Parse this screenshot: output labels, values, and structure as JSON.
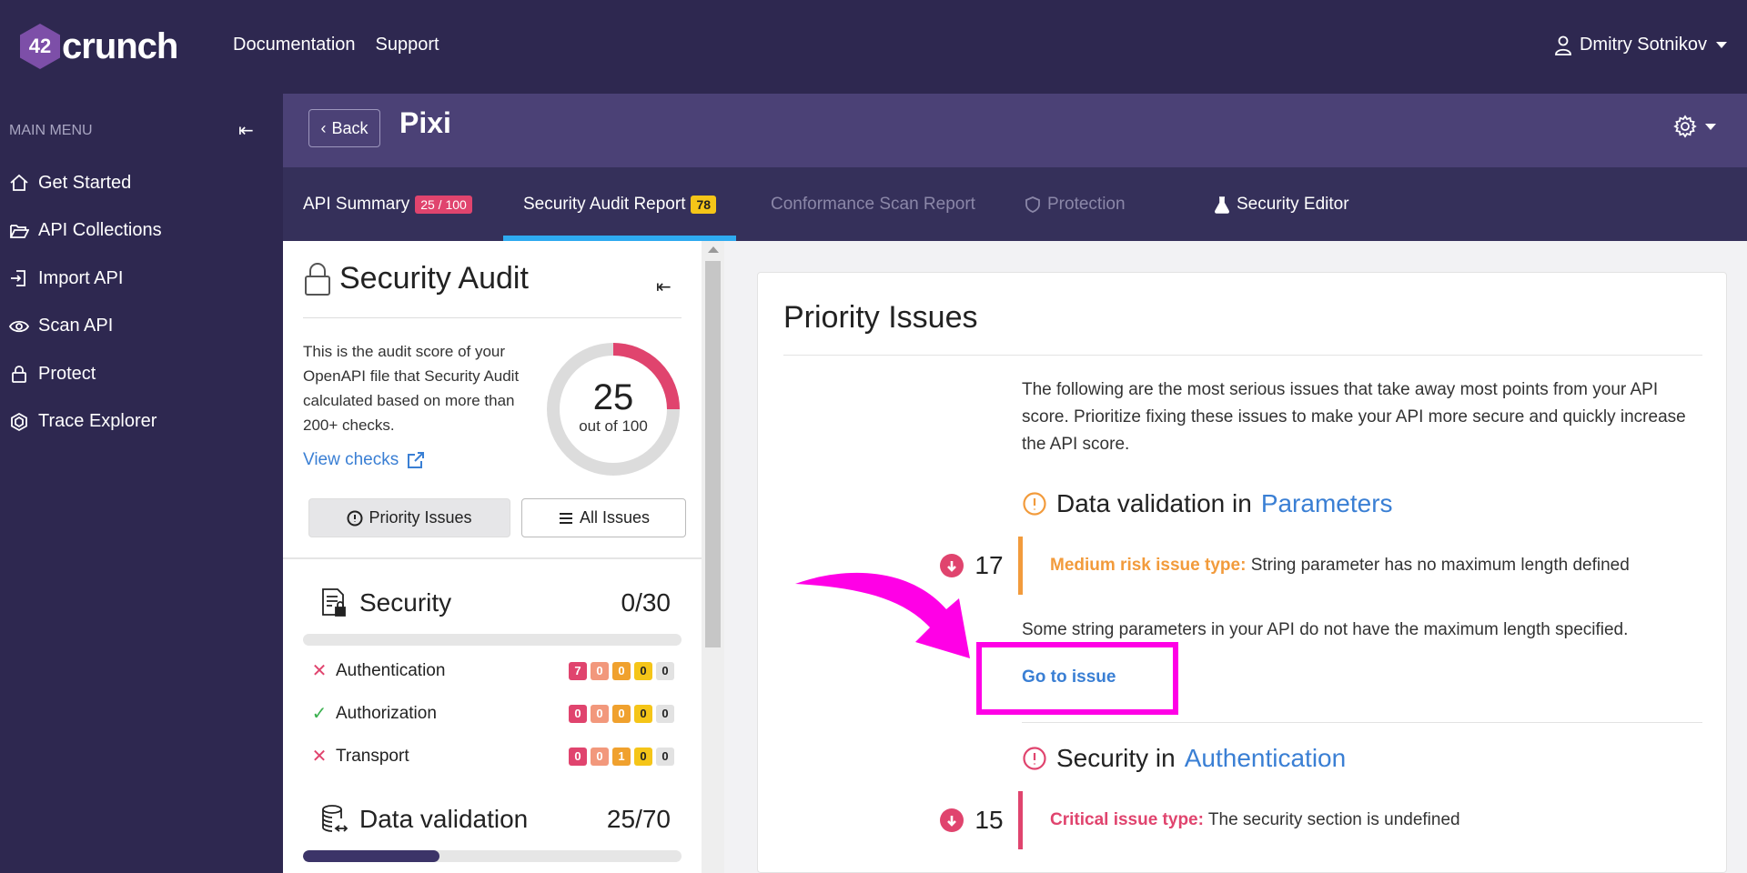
{
  "brand": {
    "logo_mark": "42",
    "logo_text": "crunch"
  },
  "topnav": {
    "documentation": "Documentation",
    "support": "Support"
  },
  "user": {
    "name": "Dmitry Sotnikov"
  },
  "sidebar": {
    "title": "MAIN MENU",
    "collapse_icon": "⇤",
    "items": [
      {
        "label": "Get Started",
        "icon": "home-icon"
      },
      {
        "label": "API Collections",
        "icon": "folder-open-icon"
      },
      {
        "label": "Import API",
        "icon": "import-icon"
      },
      {
        "label": "Scan API",
        "icon": "eye-icon"
      },
      {
        "label": "Protect",
        "icon": "lock-icon"
      },
      {
        "label": "Trace Explorer",
        "icon": "hexagon-icon"
      }
    ]
  },
  "header": {
    "back_label": "Back",
    "title": "Pixi"
  },
  "tabs": [
    {
      "label": "API Summary",
      "badge": "25 / 100"
    },
    {
      "label": "Security Audit Report",
      "badge": "78"
    },
    {
      "label": "Conformance Scan Report"
    },
    {
      "label": "Protection"
    },
    {
      "label": "Security Editor"
    }
  ],
  "audit": {
    "title": "Security Audit",
    "collapse_icon": "⇤",
    "description": "This is the audit score of your OpenAPI file that Security Audit calculated based on more than 200+ checks.",
    "view_checks": "View checks",
    "score": "25",
    "score_caption": "out of 100",
    "score_fraction": 0.25,
    "priority_button": "Priority Issues",
    "all_button": "All Issues",
    "categories": [
      {
        "name": "Security",
        "score": "0/30",
        "fill": 0.0,
        "subs": [
          {
            "name": "Authentication",
            "status": "fail",
            "mark": "✕",
            "counts": [
              "7",
              "0",
              "0",
              "0",
              "0"
            ]
          },
          {
            "name": "Authorization",
            "status": "pass",
            "mark": "✓",
            "counts": [
              "0",
              "0",
              "0",
              "0",
              "0"
            ]
          },
          {
            "name": "Transport",
            "status": "fail",
            "mark": "✕",
            "counts": [
              "0",
              "0",
              "1",
              "0",
              "0"
            ]
          }
        ]
      },
      {
        "name": "Data validation",
        "score": "25/70",
        "fill": 0.36
      }
    ]
  },
  "priority": {
    "title": "Priority Issues",
    "intro": "The following are the most serious issues that take away most points from your API score. Prioritize fixing these issues to make your API more secure and quickly increase the API score.",
    "groups": [
      {
        "prefix": "Data validation in",
        "link": "Parameters",
        "count": "17",
        "risk_label": "Medium risk issue type:",
        "risk_text": "String parameter has no maximum length defined",
        "detail": "Some string parameters in your API do not have the maximum length specified.",
        "go_to": "Go to issue"
      },
      {
        "prefix": "Security in",
        "link": "Authentication",
        "count": "15",
        "risk_label": "Critical issue type:",
        "risk_text": "The security section is undefined"
      }
    ]
  },
  "colors": {
    "accent": "#2eaaf0",
    "critical": "#e0446e",
    "medium": "#f29b3c",
    "highlight": "#ff00e6",
    "link": "#3a7fd4"
  }
}
